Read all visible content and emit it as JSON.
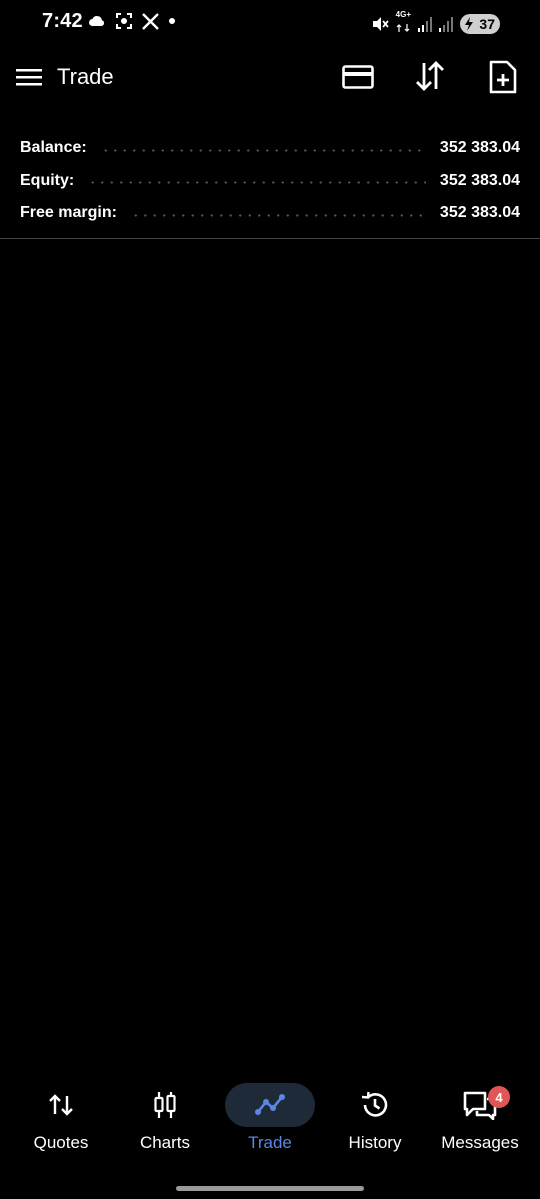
{
  "status_bar": {
    "time": "7:42",
    "network": "4G+",
    "battery": "37",
    "left_icons": [
      "cloud-icon",
      "screen-record-icon",
      "x-logo-icon",
      "dot-icon"
    ],
    "right_icons": [
      "mute-icon",
      "network-4g-icon",
      "signal-icon",
      "signal-icon",
      "battery-icon"
    ]
  },
  "app_bar": {
    "title": "Trade",
    "icons": [
      "menu-icon",
      "card-icon",
      "sort-icon",
      "new-order-icon"
    ]
  },
  "summary": {
    "rows": [
      {
        "label": "Balance:",
        "value": "352 383.04"
      },
      {
        "label": "Equity:",
        "value": "352 383.04"
      },
      {
        "label": "Free margin:",
        "value": "352 383.04"
      }
    ]
  },
  "bottom_nav": {
    "items": [
      {
        "label": "Quotes",
        "icon": "quotes-icon"
      },
      {
        "label": "Charts",
        "icon": "charts-icon"
      },
      {
        "label": "Trade",
        "icon": "trade-icon",
        "active": true
      },
      {
        "label": "History",
        "icon": "history-icon"
      },
      {
        "label": "Messages",
        "icon": "messages-icon",
        "badge": "4"
      }
    ]
  },
  "colors": {
    "background": "#000000",
    "accent": "#5b86e5",
    "active_pill": "#1f2a38",
    "badge": "#e05555",
    "divider": "#444444"
  }
}
